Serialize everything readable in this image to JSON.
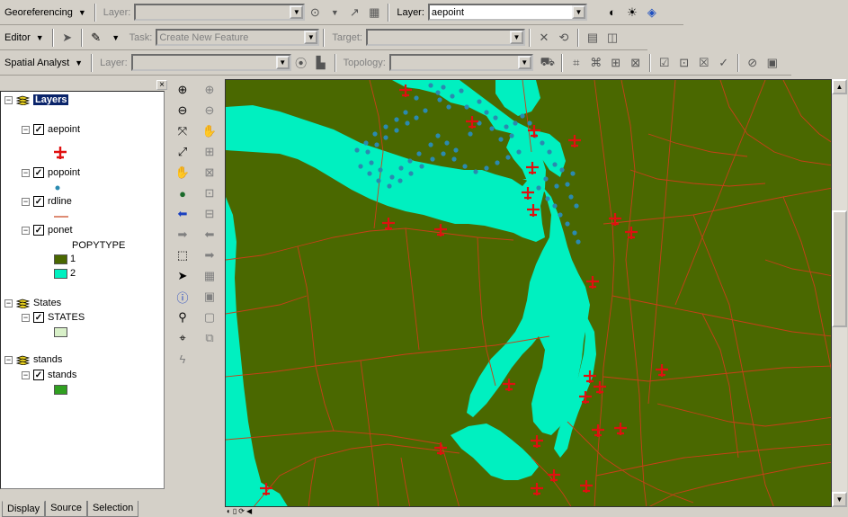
{
  "toolbar_georef": {
    "menu": "Georeferencing",
    "layer_label": "Layer:",
    "layer_value": "",
    "layer2_label": "Layer:",
    "layer2_value": "aepoint"
  },
  "toolbar_editor": {
    "menu": "Editor",
    "task_label": "Task:",
    "task_value": "Create New Feature",
    "target_label": "Target:",
    "target_value": ""
  },
  "toolbar_spatial": {
    "menu": "Spatial Analyst",
    "layer_label": "Layer:",
    "layer_value": "",
    "topology_label": "Topology:",
    "topology_value": ""
  },
  "toc": {
    "root": "Layers",
    "layers": [
      {
        "name": "aepoint",
        "checked": true
      },
      {
        "name": "popoint",
        "checked": true
      },
      {
        "name": "rdline",
        "checked": true
      },
      {
        "name": "ponet",
        "checked": true,
        "field": "POPYTYPE",
        "classes": [
          "1",
          "2"
        ]
      },
      {
        "name": "States",
        "checked": true,
        "sub": "STATES"
      },
      {
        "name": "stands",
        "checked": true,
        "sub": "stands"
      }
    ],
    "tabs": [
      "Display",
      "Source",
      "Selection"
    ]
  },
  "colors": {
    "land": "#4a6800",
    "water": "#00f0c0",
    "roads": "#c84018",
    "airports": "#e01010",
    "popoint": "#2a8ab0",
    "states_fill": "#d8f0c8",
    "stands_fill": "#30a020"
  },
  "icons": {
    "map_tools": [
      "zoom-in-icon",
      "zoom-out-icon",
      "fixed-zoom-in-icon",
      "fixed-zoom-out-icon",
      "pan-icon",
      "full-extent-icon",
      "back-extent-icon",
      "forward-extent-icon",
      "select-features-icon",
      "select-elements-icon",
      "identify-icon",
      "find-icon",
      "measure-icon",
      "hyperlink-icon"
    ]
  }
}
